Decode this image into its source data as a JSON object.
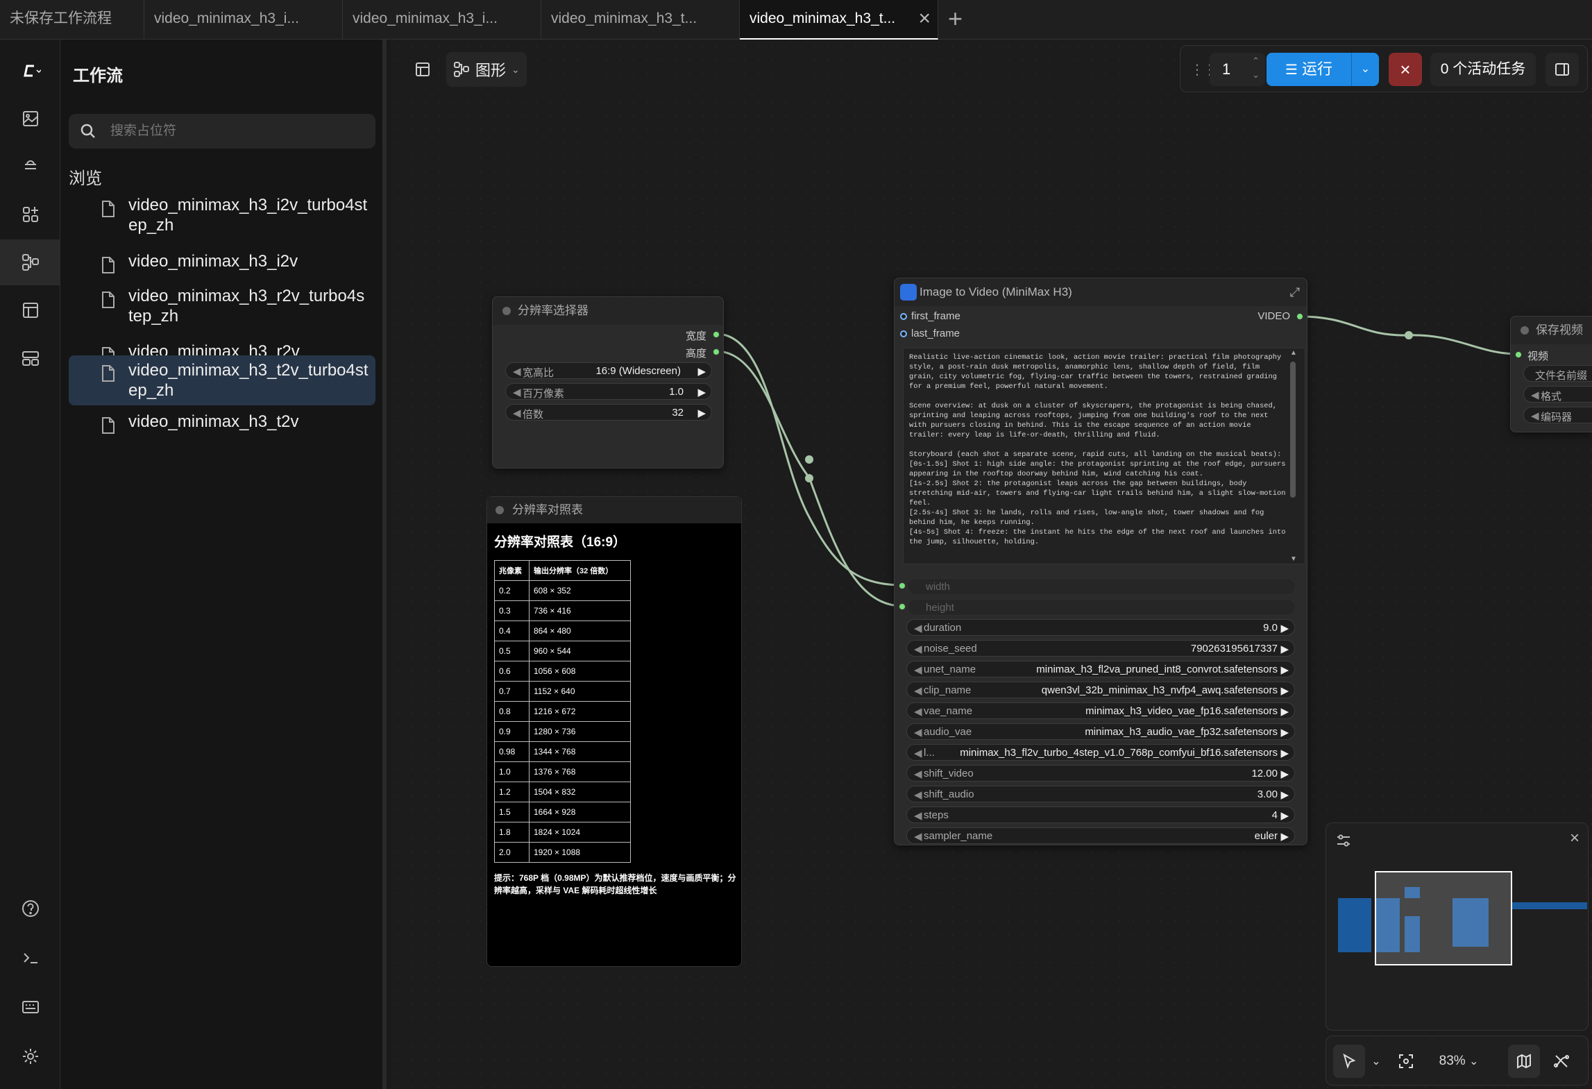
{
  "tabs": [
    {
      "label": "未保存工作流程"
    },
    {
      "label": "video_minimax_h3_i..."
    },
    {
      "label": "video_minimax_h3_i..."
    },
    {
      "label": "video_minimax_h3_t..."
    },
    {
      "label": "video_minimax_h3_t..."
    }
  ],
  "sidebar": {
    "title": "工作流",
    "search_placeholder": "搜索占位符",
    "browse_label": "浏览",
    "items": [
      {
        "label": "video_minimax_h3_i2v_turbo4step_zh"
      },
      {
        "label": "video_minimax_h3_i2v"
      },
      {
        "label": "video_minimax_h3_r2v_turbo4step_zh"
      },
      {
        "label": "video_minimax_h3_r2v"
      },
      {
        "label": "video_minimax_h3_t2v_turbo4step_zh"
      },
      {
        "label": "video_minimax_h3_t2v"
      }
    ]
  },
  "toolbar": {
    "graph_label": "图形",
    "run_count": "1",
    "run_label": "运行",
    "tasks_label": "0 个活动任务"
  },
  "resolution_selector": {
    "title": "分辨率选择器",
    "out_width": "宽度",
    "out_height": "高度",
    "widgets": [
      {
        "label": "宽高比",
        "value": "16:9 (Widescreen)"
      },
      {
        "label": "百万像素",
        "value": "1.0"
      },
      {
        "label": "倍数",
        "value": "32"
      }
    ]
  },
  "resolution_table": {
    "title": "分辨率对照表",
    "heading": "分辨率对照表（16:9）",
    "col1": "兆像素",
    "col2": "输出分辨率（32 倍数）",
    "rows": [
      [
        "0.2",
        "608 × 352"
      ],
      [
        "0.3",
        "736 × 416"
      ],
      [
        "0.4",
        "864 × 480"
      ],
      [
        "0.5",
        "960 × 544"
      ],
      [
        "0.6",
        "1056 × 608"
      ],
      [
        "0.7",
        "1152 × 640"
      ],
      [
        "0.8",
        "1216 × 672"
      ],
      [
        "0.9",
        "1280 × 736"
      ],
      [
        "0.98",
        "1344 × 768"
      ],
      [
        "1.0",
        "1376 × 768"
      ],
      [
        "1.2",
        "1504 × 832"
      ],
      [
        "1.5",
        "1664 × 928"
      ],
      [
        "1.8",
        "1824 × 1024"
      ],
      [
        "2.0",
        "1920 × 1088"
      ]
    ],
    "note": "提示：768P 档（0.98MP）为默认推荐档位，速度与画质平衡；分辨率越高，采样与 VAE 解码耗时超线性增长"
  },
  "i2v_node": {
    "title": "Image to Video (MiniMax H3)",
    "input_first_frame": "first_frame",
    "input_last_frame": "last_frame",
    "output_video": "VIDEO",
    "prompt": "Realistic live-action cinematic look, action movie trailer: practical film photography style, a post-rain dusk metropolis, anamorphic lens, shallow depth of field, film grain, city volumetric fog, flying-car traffic between the towers, restrained grading for a premium feel, powerful natural movement.\n\nScene overview: at dusk on a cluster of skyscrapers, the protagonist is being chased, sprinting and leaping across rooftops, jumping from one building's roof to the next with pursuers closing in behind. This is the escape sequence of an action movie trailer: every leap is life-or-death, thrilling and fluid.\n\nStoryboard (each shot a separate scene, rapid cuts, all landing on the musical beats):\n[0s-1.5s] Shot 1: high side angle: the protagonist sprinting at the roof edge, pursuers appearing in the rooftop doorway behind him, wind catching his coat.\n[1s-2.5s] Shot 2: the protagonist leaps across the gap between buildings, body stretching mid-air, towers and flying-car light trails behind him, a slight slow-motion feel.\n[2.5s-4s] Shot 3: he lands, rolls and rises, low-angle shot, tower shadows and fog behind him, he keeps running.\n[4s-5s] Shot 4: freeze: the instant he hits the edge of the next roof and launches into the jump, silhouette, holding.",
    "input_width": "width",
    "input_height": "height",
    "widgets": [
      {
        "label": "duration",
        "value": "9.0"
      },
      {
        "label": "noise_seed",
        "value": "790263195617337"
      },
      {
        "label": "unet_name",
        "value": "minimax_h3_fl2va_pruned_int8_convrot.safetensors"
      },
      {
        "label": "clip_name",
        "value": "qwen3vl_32b_minimax_h3_nvfp4_awq.safetensors"
      },
      {
        "label": "vae_name",
        "value": "minimax_h3_video_vae_fp16.safetensors"
      },
      {
        "label": "audio_vae",
        "value": "minimax_h3_audio_vae_fp32.safetensors"
      },
      {
        "label": "l...",
        "value": "minimax_h3_fl2v_turbo_4step_v1.0_768p_comfyui_bf16.safetensors"
      },
      {
        "label": "shift_video",
        "value": "12.00"
      },
      {
        "label": "shift_audio",
        "value": "3.00"
      },
      {
        "label": "steps",
        "value": "4"
      },
      {
        "label": "sampler_name",
        "value": "euler"
      }
    ]
  },
  "save_node": {
    "title": "保存视频",
    "input_video": "视频",
    "widgets": [
      {
        "label": "文件名前缀"
      },
      {
        "label": "格式"
      },
      {
        "label": "编码器"
      }
    ]
  },
  "bottom_controls": {
    "zoom": "83%"
  },
  "colors": {
    "accent": "#1e8ae6",
    "stop": "#8a2b2b",
    "selected_item": "#273548",
    "link": "#a8c4a8"
  }
}
